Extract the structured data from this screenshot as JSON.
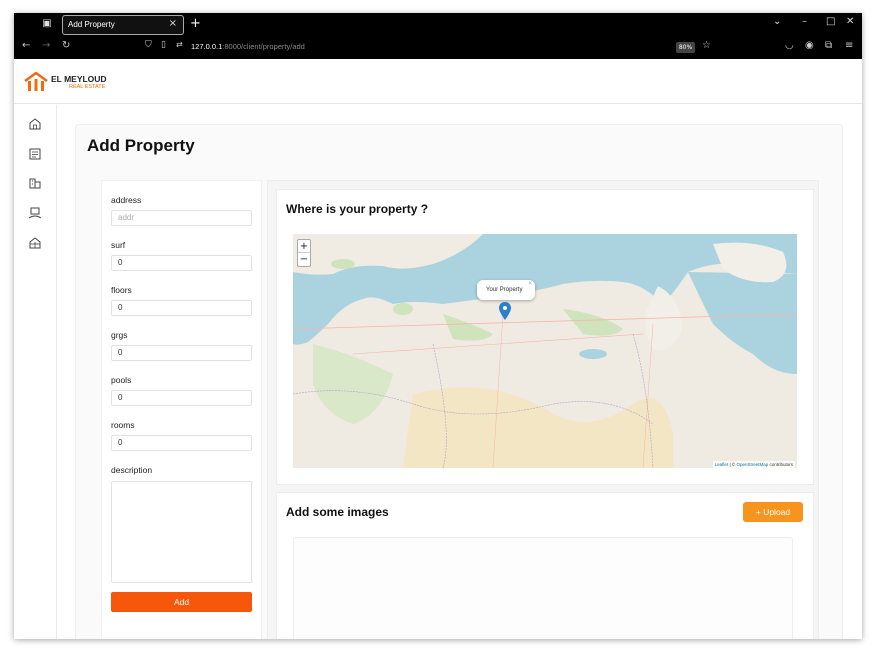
{
  "browser": {
    "tab_title": "Add Property",
    "tab_close": "×",
    "new_tab": "+",
    "url_host": "127.0.0.1",
    "url_rest": ":8000/client/property/add",
    "zoom": "80%"
  },
  "header": {
    "brand_name": "EL MEYLOUD",
    "brand_sub": "REAL ESTATE",
    "accent_color": "#f26a0d"
  },
  "sidebar": {
    "items": [
      {
        "icon": "home-icon"
      },
      {
        "icon": "listings-icon"
      },
      {
        "icon": "buildings-icon"
      },
      {
        "icon": "agent-desk-icon"
      },
      {
        "icon": "house-box-icon"
      }
    ],
    "bottom_icon": "user-icon"
  },
  "main": {
    "title": "Add Property",
    "form": {
      "fields": [
        {
          "label": "address",
          "value": "",
          "placeholder": "addr"
        },
        {
          "label": "surf",
          "value": "0"
        },
        {
          "label": "floors",
          "value": "0"
        },
        {
          "label": "grgs",
          "value": "0"
        },
        {
          "label": "pools",
          "value": "0"
        },
        {
          "label": "rooms",
          "value": "0"
        }
      ],
      "description_label": "description",
      "submit_label": "Add",
      "submit_color": "#f7570b"
    },
    "map_section": {
      "title": "Where is your property ?",
      "zoom_in": "+",
      "zoom_out": "−",
      "popup_text": "Your Property",
      "popup_close": "×",
      "attribution_leaflet": "Leaflet",
      "attribution_osm": "OpenStreetMap",
      "attribution_suffix": "contributors"
    },
    "images_section": {
      "title": "Add some images",
      "upload_label": "+ Upload",
      "upload_color": "#f7941d"
    }
  }
}
